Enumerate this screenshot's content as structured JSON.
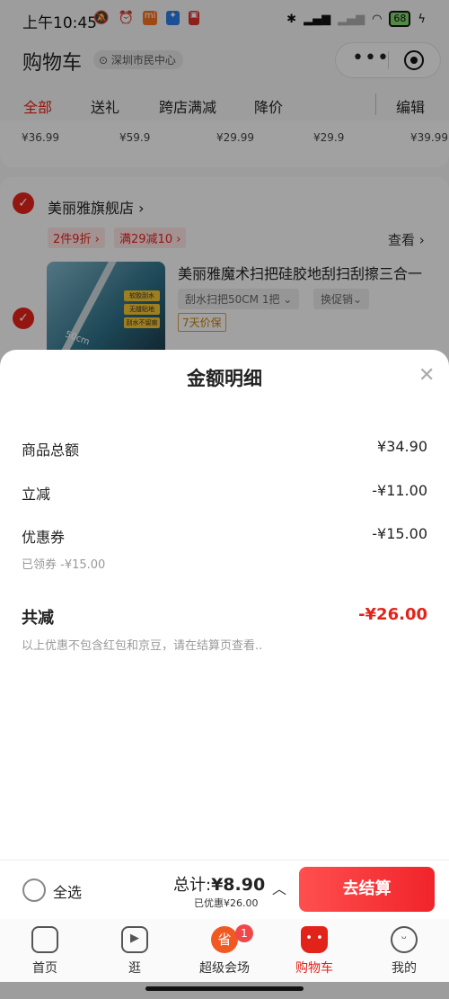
{
  "status_bar": {
    "time": "上午10:45",
    "battery": "68"
  },
  "header": {
    "title": "购物车",
    "location": "深圳市民中心",
    "more_icon": "more-dots-icon",
    "close_icon": "target-icon"
  },
  "tabs": [
    {
      "label": "全部",
      "active": true
    },
    {
      "label": "送礼"
    },
    {
      "label": "跨店满减"
    },
    {
      "label": "降价"
    },
    {
      "label": "编辑"
    }
  ],
  "top_prices": [
    "¥36.99",
    "¥59.9",
    "¥29.99",
    "¥29.9",
    "¥39.99"
  ],
  "shop": {
    "name": "美丽雅旗舰店",
    "promos": [
      "2件9折",
      "满29减10"
    ],
    "view_link": "查看",
    "product": {
      "title": "美丽雅魔术扫把硅胶地刮扫刮擦三合一",
      "spec": "刮水扫把50CM 1把",
      "promo_select": "换促销",
      "guarantee": "7天价保",
      "badges": [
        "软胶刮水",
        "无缝贴地",
        "刮水不留痕"
      ],
      "image_label": "50cm"
    }
  },
  "sheet": {
    "title": "金额明细",
    "rows": [
      {
        "label": "商品总额",
        "value": "¥34.90"
      },
      {
        "label": "立减",
        "value": "-¥11.00"
      },
      {
        "label": "优惠券",
        "value": "-¥15.00",
        "sub": "已领券 -¥15.00"
      }
    ],
    "total_label": "共减",
    "total_value": "-¥26.00",
    "note": "以上优惠不包含红包和京豆，请在结算页查看.."
  },
  "checkout": {
    "select_all": "全选",
    "total_prefix": "总计:",
    "total_amount": "¥8.90",
    "saved": "已优惠¥26.00",
    "pay_button": "去结算"
  },
  "tabbar": [
    {
      "label": "首页",
      "icon": "home-face-icon"
    },
    {
      "label": "逛",
      "icon": "play-video-icon"
    },
    {
      "label": "超级会场",
      "icon": "super-venue-icon",
      "badge": "1"
    },
    {
      "label": "购物车",
      "icon": "cart-icon",
      "active": true
    },
    {
      "label": "我的",
      "icon": "profile-face-icon"
    }
  ],
  "colors": {
    "accent": "#e2231a",
    "pay_gradient_start": "#ff4f4f",
    "pay_gradient_end": "#f0242a"
  }
}
